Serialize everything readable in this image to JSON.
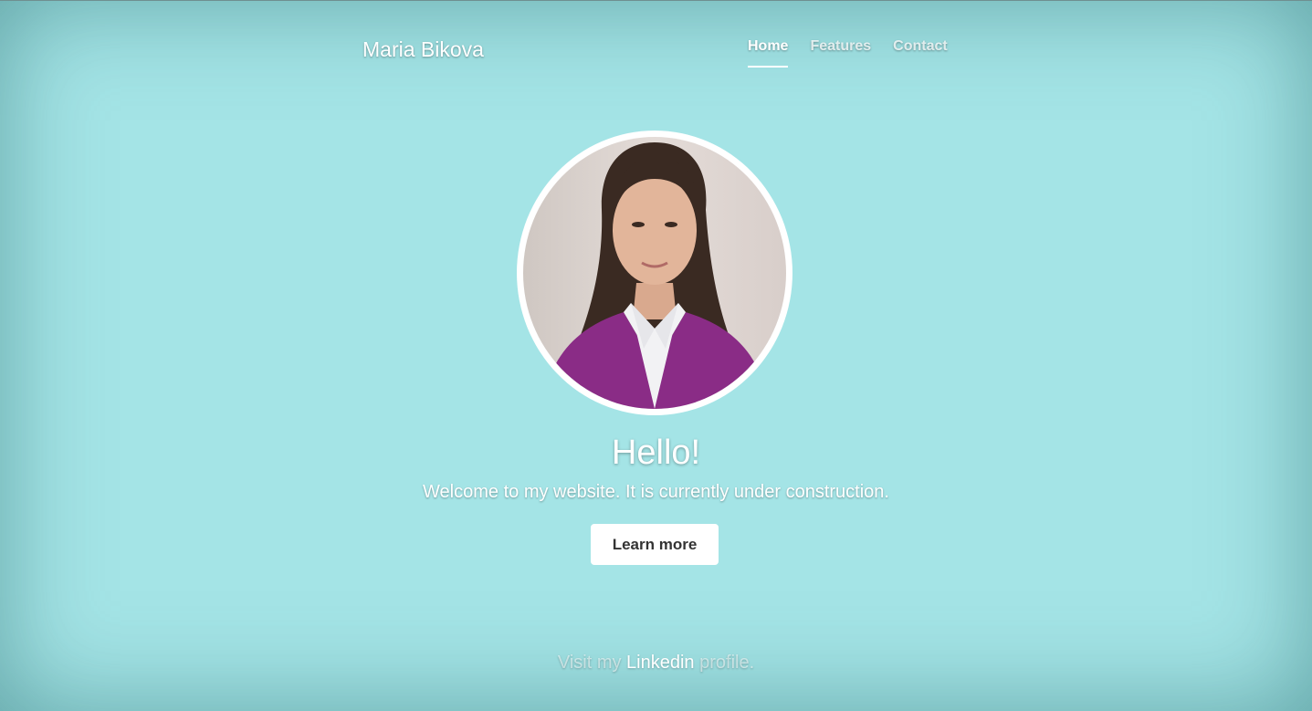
{
  "header": {
    "brand": "Maria Bikova",
    "nav": [
      {
        "label": "Home",
        "active": true
      },
      {
        "label": "Features",
        "active": false
      },
      {
        "label": "Contact",
        "active": false
      }
    ]
  },
  "hero": {
    "title": "Hello!",
    "subtitle": "Welcome to my website. It is currently under construction.",
    "button_label": "Learn more"
  },
  "footer": {
    "prefix": "Visit my",
    "link_label": "Linkedin",
    "suffix": "profile."
  },
  "colors": {
    "background": "#a4e4e6",
    "text": "#ffffff",
    "button_text": "#333333"
  }
}
